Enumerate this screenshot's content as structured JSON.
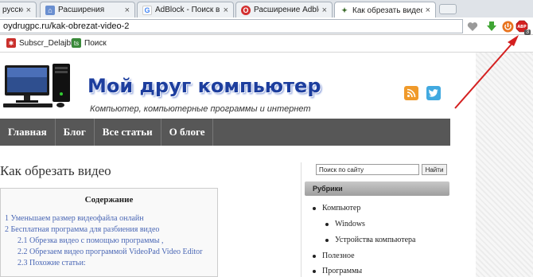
{
  "tabs": [
    {
      "label": "русскоязы",
      "favicon": "page-icon",
      "active": false
    },
    {
      "label": "Расширения",
      "favicon": "puzzle-icon",
      "active": false
    },
    {
      "label": "AdBlock - Поиск в Google",
      "favicon": "google-icon",
      "active": false
    },
    {
      "label": "Расширение Adblock Plu",
      "favicon": "opera-icon",
      "active": false
    },
    {
      "label": "Как обрезать видео на ко",
      "favicon": "site-icon",
      "active": true
    }
  ],
  "address": {
    "url": "oydrugpc.ru/kak-obrezat-video-2"
  },
  "toolbar_icons": [
    "heart-icon",
    "download-icon",
    "power-icon",
    "adblock-icon"
  ],
  "adblock_badge": "3",
  "bookmarks": [
    {
      "label": "Subscr_Delajblog",
      "icon": "gear-icon"
    },
    {
      "label": "Поиск",
      "icon": "search-icon"
    }
  ],
  "site": {
    "title": "Мой друг компьютер",
    "tagline": "Компьютер, компьютерные программы и интернет"
  },
  "nav": [
    "Главная",
    "Блог",
    "Все статьи",
    "О блоге"
  ],
  "article": {
    "title": "Как обрезать видео"
  },
  "toc": {
    "heading": "Содержание",
    "items": [
      "1 Уменьшаем размер видеофайла онлайн",
      "2 Бесплатная программа для разбиения видео",
      "2.1 Обрезка видео с помощью программы ,",
      "2.2 Обрезаем видео программой VideoPad Video Editor",
      "2.3 Похожие статьи:"
    ]
  },
  "sidebar": {
    "search_value": "Поиск по сайту",
    "search_button": "Найти",
    "widget_title": "Рубрики",
    "categories": [
      "Компьютер",
      "Windows",
      "Устройства компьютера",
      "Полезное",
      "Программы"
    ]
  },
  "colors": {
    "accent": "#1d3e9e",
    "nav_bg": "#575757",
    "link": "#4a67b5",
    "arrow": "#d42020"
  }
}
